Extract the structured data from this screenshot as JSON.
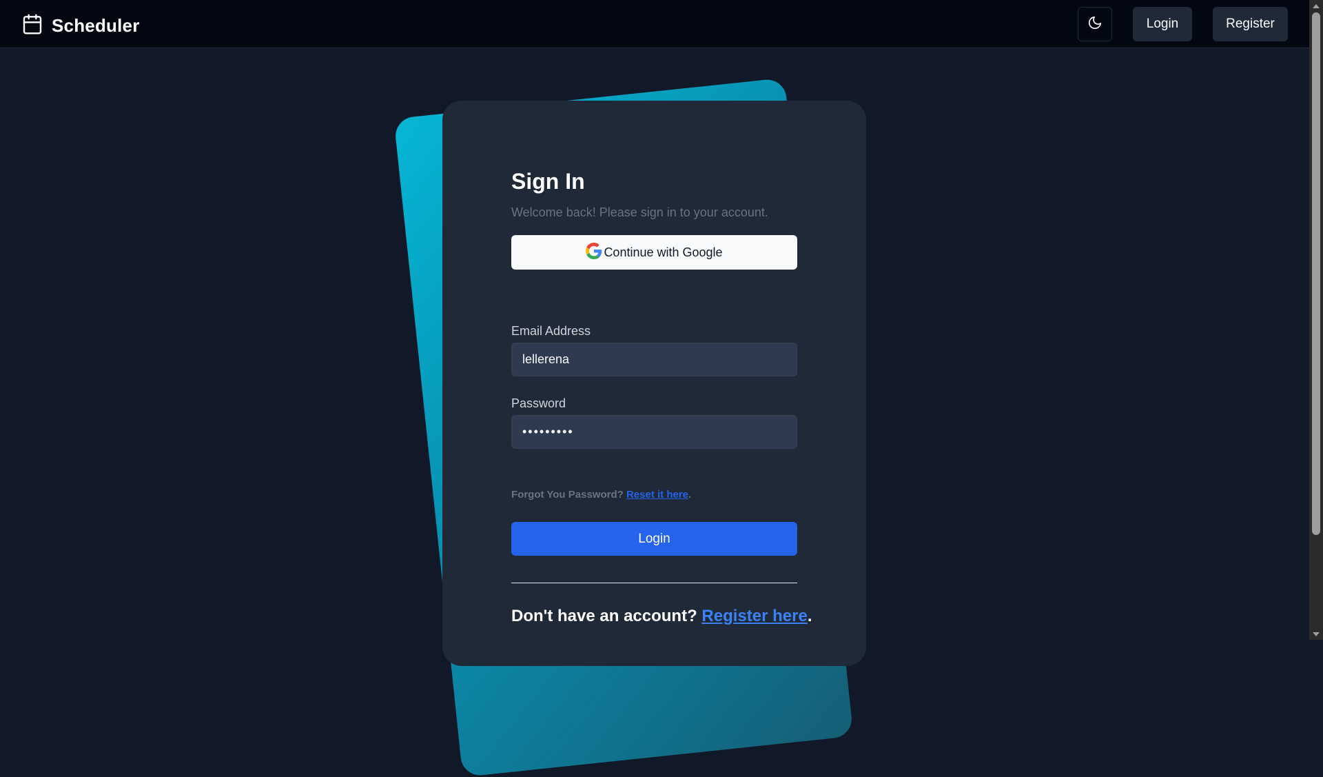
{
  "navbar": {
    "brand_icon": "calendar-icon",
    "brand_name": "Scheduler",
    "theme_icon": "moon-icon",
    "login_label": "Login",
    "register_label": "Register"
  },
  "signin": {
    "title": "Sign In",
    "subtitle": "Welcome back! Please sign in to your account.",
    "google_icon": "google-icon",
    "google_label": "Continue with Google",
    "email_label": "Email Address",
    "email_value": "lellerena",
    "password_label": "Password",
    "password_value": "•••••••••",
    "forgot_text": "Forgot You Password?",
    "forgot_link": "Reset it here",
    "forgot_suffix": ".",
    "login_label": "Login",
    "register_prompt": "Don't have an account?",
    "register_link": "Register here",
    "register_suffix": "."
  },
  "colors": {
    "background": "#111827",
    "navbar": "#030712",
    "card": "#1f2937",
    "accent": "#2563eb",
    "back_card": "#0891b2"
  }
}
